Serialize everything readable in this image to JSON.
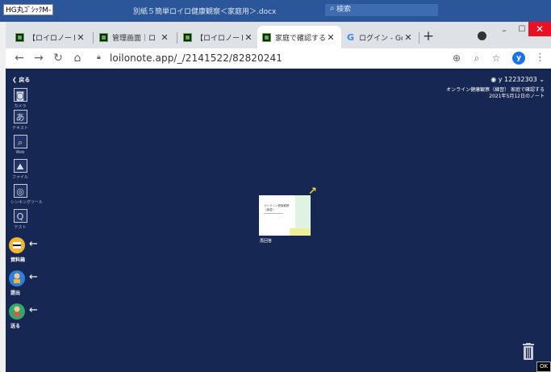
{
  "word": {
    "font_name": "HG丸ｺﾞｼｯｸM-",
    "doc_title": "別紙５簡単ロイロ健康観察＜家庭用＞.docx",
    "search_placeholder": "検索"
  },
  "browser": {
    "tabs": [
      {
        "title": "【ロイロノート・ス",
        "favicon": "loilo-icon",
        "active": false
      },
      {
        "title": "管理画面｜ロ",
        "favicon": "loilo-icon",
        "active": false
      },
      {
        "title": "【ロイロノート・ス",
        "favicon": "loilo-icon",
        "active": false
      },
      {
        "title": "家庭で確認する",
        "favicon": "loilo-icon",
        "active": true
      },
      {
        "title": "ログイン - Goo",
        "favicon": "google-icon",
        "active": false
      }
    ],
    "new_tab": "+",
    "url": "loilonote.app/_/2141522/82820241",
    "profile_initial": "y"
  },
  "app": {
    "back_label": "戻る",
    "sidebar": [
      {
        "name": "camera",
        "icon": "camera-icon",
        "glyph": "◙",
        "label": "カメラ"
      },
      {
        "name": "text",
        "icon": "text-icon",
        "glyph": "あ",
        "label": "テキスト"
      },
      {
        "name": "web",
        "icon": "web-icon",
        "glyph": "⌕",
        "label": "Web"
      },
      {
        "name": "file",
        "icon": "file-icon",
        "glyph": "⛰",
        "label": "ファイル"
      },
      {
        "name": "thinking-tool",
        "icon": "thinking-tool-icon",
        "glyph": "◎",
        "label": "シンキングツール"
      },
      {
        "name": "test",
        "icon": "test-icon",
        "glyph": "Q",
        "label": "テスト"
      }
    ],
    "actions": [
      {
        "name": "material",
        "icon": "material-box-icon",
        "label": "資料箱",
        "color": "#f2b632"
      },
      {
        "name": "submit",
        "icon": "submit-icon",
        "label": "提出",
        "color": "#2f7fdc"
      },
      {
        "name": "send",
        "icon": "send-icon",
        "label": "送る",
        "color": "#2fa86a"
      }
    ],
    "user": "y 12232303",
    "class_line": "オンライン健康観察（練習） 家庭で確認する",
    "date_line": "2021年5月12日のノート",
    "card_caption": "再回答",
    "card_text_1": "オンライン健康観察",
    "card_text_2": "（練習）",
    "ok_label": "OK"
  }
}
